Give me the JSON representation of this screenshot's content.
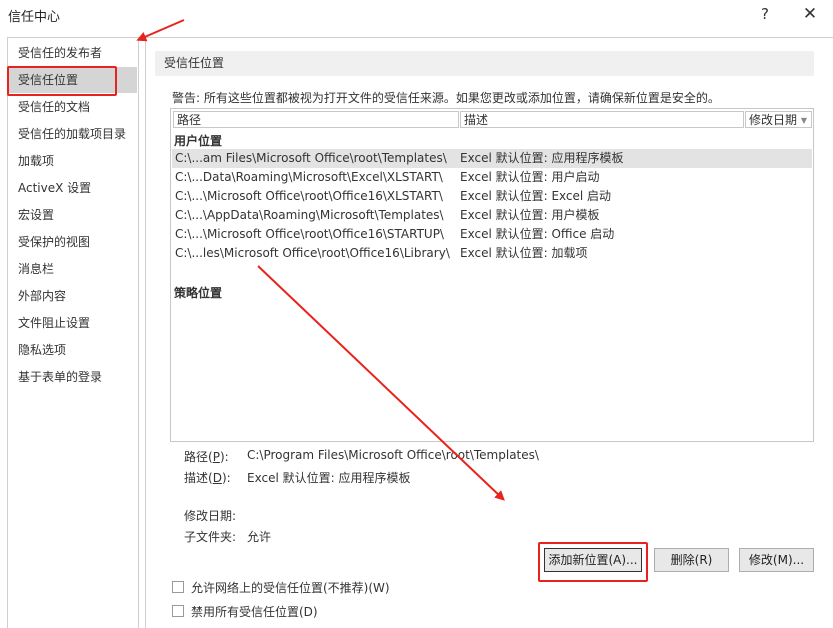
{
  "window": {
    "title": "信任中心",
    "help_label": "?",
    "close_label": "✕"
  },
  "sidebar": {
    "items": [
      {
        "label": "受信任的发布者"
      },
      {
        "label": "受信任位置"
      },
      {
        "label": "受信任的文档"
      },
      {
        "label": "受信任的加载项目录"
      },
      {
        "label": "加载项"
      },
      {
        "label": "ActiveX 设置"
      },
      {
        "label": "宏设置"
      },
      {
        "label": "受保护的视图"
      },
      {
        "label": "消息栏"
      },
      {
        "label": "外部内容"
      },
      {
        "label": "文件阻止设置"
      },
      {
        "label": "隐私选项"
      },
      {
        "label": "基于表单的登录"
      }
    ],
    "selected_index": 1
  },
  "main": {
    "section_title": "受信任位置",
    "warning": "警告: 所有这些位置都被视为打开文件的受信任来源。如果您更改或添加位置，请确保新位置是安全的。",
    "table": {
      "headers": {
        "path": "路径",
        "description": "描述",
        "date": "修改日期"
      },
      "sort_arrow": "▼",
      "user_group": "用户位置",
      "rows": [
        {
          "path": "C:\\...am Files\\Microsoft Office\\root\\Templates\\",
          "description": "Excel 默认位置: 应用程序模板"
        },
        {
          "path": "C:\\...Data\\Roaming\\Microsoft\\Excel\\XLSTART\\",
          "description": "Excel 默认位置: 用户启动"
        },
        {
          "path": "C:\\...\\Microsoft Office\\root\\Office16\\XLSTART\\",
          "description": "Excel 默认位置: Excel 启动"
        },
        {
          "path": "C:\\...\\AppData\\Roaming\\Microsoft\\Templates\\",
          "description": "Excel 默认位置: 用户模板"
        },
        {
          "path": "C:\\...\\Microsoft Office\\root\\Office16\\STARTUP\\",
          "description": "Excel 默认位置: Office 启动"
        },
        {
          "path": "C:\\...les\\Microsoft Office\\root\\Office16\\Library\\",
          "description": "Excel 默认位置: 加载项"
        }
      ],
      "selected_row": 0,
      "policy_group": "策略位置"
    },
    "details": {
      "path_label": "路径(",
      "path_key": "P",
      "path_label_end": "):",
      "path_value": "C:\\Program Files\\Microsoft Office\\root\\Templates\\",
      "desc_label": "描述(",
      "desc_key": "D",
      "desc_label_end": "):",
      "desc_value": "Excel 默认位置: 应用程序模板",
      "date_label": "修改日期:",
      "date_value": "",
      "subfolder_label": "子文件夹:",
      "subfolder_value": "允许"
    },
    "buttons": {
      "add": "添加新位置(A)...",
      "delete": "删除(R)",
      "modify": "修改(M)..."
    },
    "checkboxes": [
      {
        "label": "允许网络上的受信任位置(不推荐)(W)",
        "checked": false
      },
      {
        "label": "禁用所有受信任位置(D)",
        "checked": false
      }
    ]
  },
  "annotations": {
    "highlight_color": "#e8231d"
  }
}
